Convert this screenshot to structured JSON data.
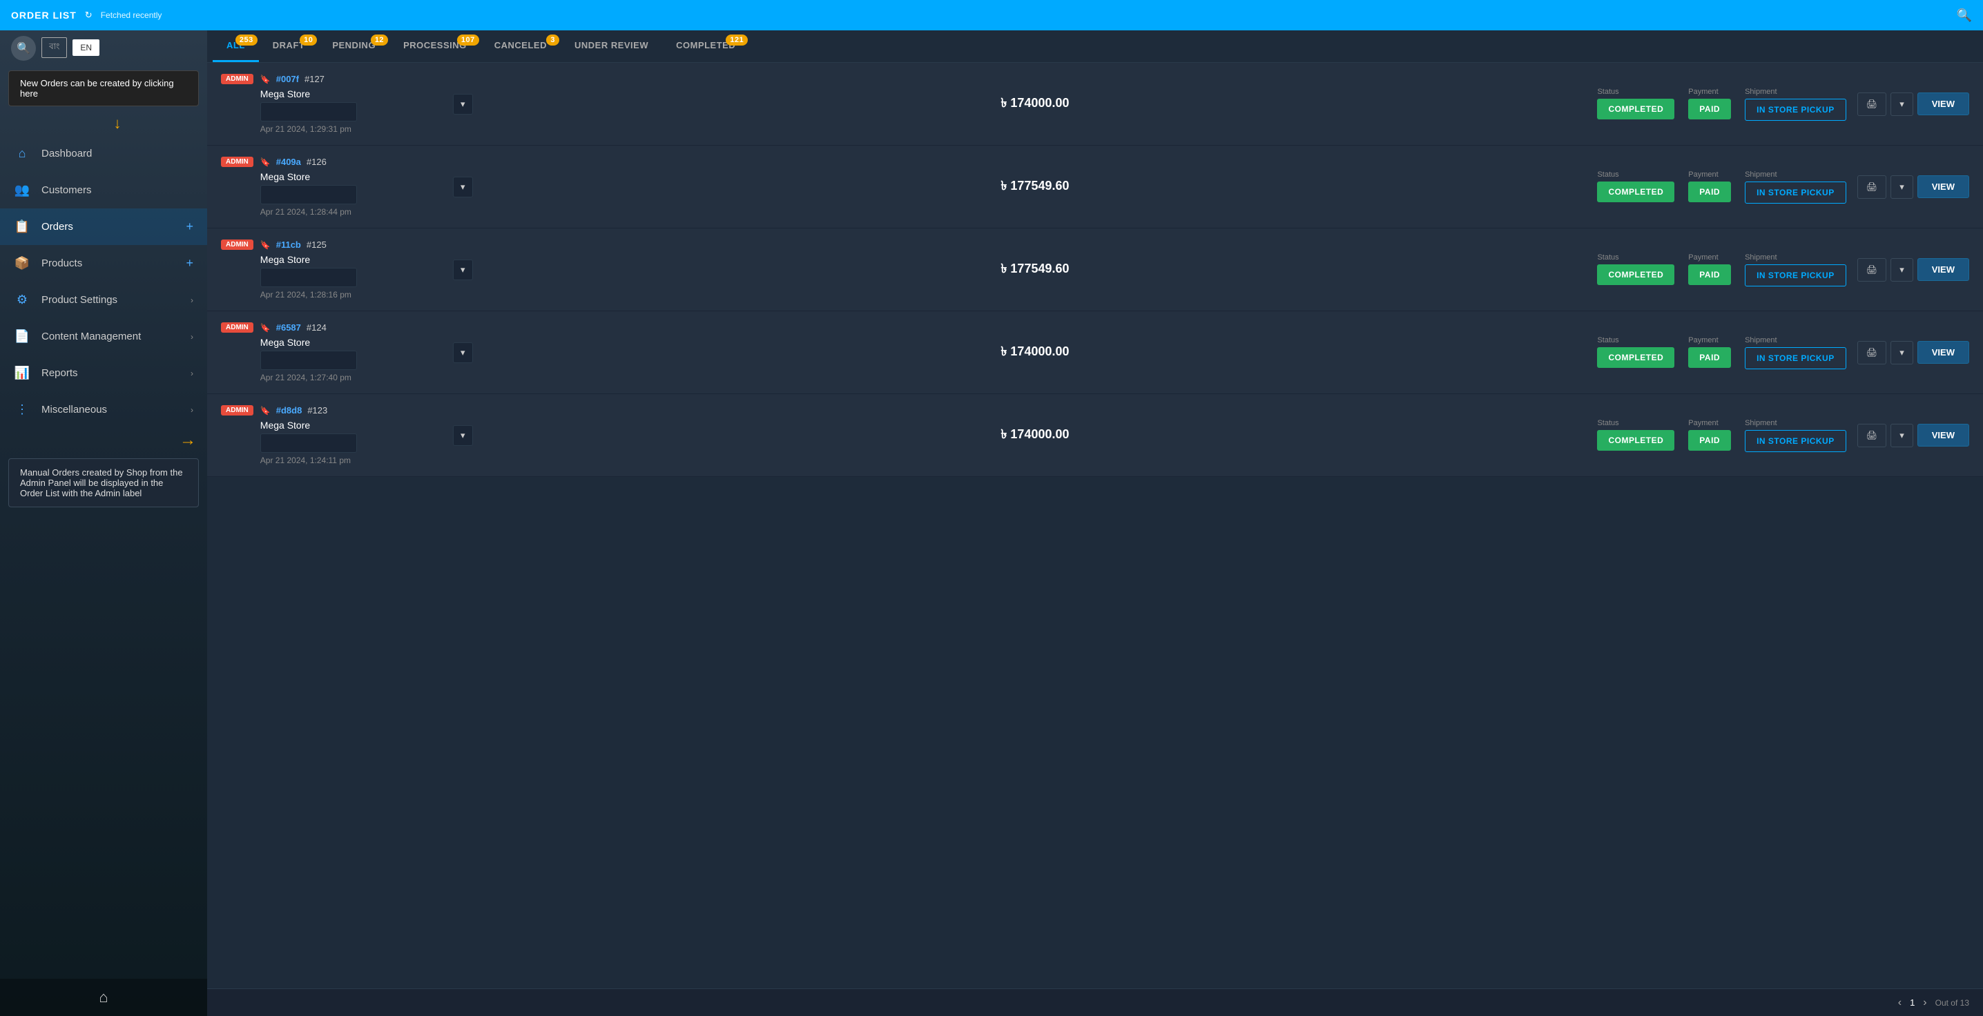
{
  "topbar": {
    "title": "ORDER LIST",
    "refresh_icon": "↻",
    "fetched_label": "Fetched recently",
    "search_icon": "🔍"
  },
  "language": {
    "options": [
      "বাং",
      "EN"
    ],
    "active": "EN"
  },
  "nav": {
    "items": [
      {
        "id": "dashboard",
        "label": "Dashboard",
        "icon": "⌂",
        "has_arrow": false,
        "has_add": false,
        "active": false
      },
      {
        "id": "customers",
        "label": "Customers",
        "icon": "👥",
        "has_arrow": false,
        "has_add": false,
        "active": false
      },
      {
        "id": "orders",
        "label": "Orders",
        "icon": "📋",
        "has_arrow": false,
        "has_add": true,
        "active": true
      },
      {
        "id": "products",
        "label": "Products",
        "icon": "📦",
        "has_arrow": false,
        "has_add": true,
        "active": false
      },
      {
        "id": "product-settings",
        "label": "Product Settings",
        "icon": "⚙",
        "has_arrow": true,
        "has_add": false,
        "active": false
      },
      {
        "id": "content-management",
        "label": "Content Management",
        "icon": "📄",
        "has_arrow": true,
        "has_add": false,
        "active": false
      },
      {
        "id": "reports",
        "label": "Reports",
        "icon": "📊",
        "has_arrow": true,
        "has_add": false,
        "active": false
      },
      {
        "id": "miscellaneous",
        "label": "Miscellaneous",
        "icon": "⋮",
        "has_arrow": true,
        "has_add": false,
        "active": false
      }
    ]
  },
  "tooltips": {
    "top": "New Orders can be created by clicking here",
    "bottom": "Manual Orders created by Shop from the Admin Panel will be displayed in the Order List with the Admin label"
  },
  "tabs": [
    {
      "id": "all",
      "label": "ALL",
      "badge": "253",
      "active": true
    },
    {
      "id": "draft",
      "label": "DRAFT",
      "badge": "10",
      "active": false
    },
    {
      "id": "pending",
      "label": "PENDING",
      "badge": "12",
      "active": false
    },
    {
      "id": "processing",
      "label": "PROCESSING",
      "badge": "107",
      "active": false
    },
    {
      "id": "canceled",
      "label": "CANCELED",
      "badge": "3",
      "active": false
    },
    {
      "id": "under-review",
      "label": "UNDER REVIEW",
      "badge": null,
      "active": false
    },
    {
      "id": "completed",
      "label": "COMPLETED",
      "badge": "121",
      "active": false
    }
  ],
  "orders": [
    {
      "admin": true,
      "hash_id": "#007f",
      "order_num": "#127",
      "store": "Mega Store",
      "date": "Apr 21 2024, 1:29:31 pm",
      "amount": "৳ 174000.00",
      "status": "COMPLETED",
      "payment": "PAID",
      "shipment": "IN STORE PICKUP"
    },
    {
      "admin": true,
      "hash_id": "#409a",
      "order_num": "#126",
      "store": "Mega Store",
      "date": "Apr 21 2024, 1:28:44 pm",
      "amount": "৳ 177549.60",
      "status": "COMPLETED",
      "payment": "PAID",
      "shipment": "IN STORE PICKUP"
    },
    {
      "admin": true,
      "hash_id": "#11cb",
      "order_num": "#125",
      "store": "Mega Store",
      "date": "Apr 21 2024, 1:28:16 pm",
      "amount": "৳ 177549.60",
      "status": "COMPLETED",
      "payment": "PAID",
      "shipment": "IN STORE PICKUP"
    },
    {
      "admin": true,
      "hash_id": "#6587",
      "order_num": "#124",
      "store": "Mega Store",
      "date": "Apr 21 2024, 1:27:40 pm",
      "amount": "৳ 174000.00",
      "status": "COMPLETED",
      "payment": "PAID",
      "shipment": "IN STORE PICKUP"
    },
    {
      "admin": true,
      "hash_id": "#d8d8",
      "order_num": "#123",
      "store": "Mega Store",
      "date": "Apr 21 2024, 1:24:11 pm",
      "amount": "৳ 174000.00",
      "status": "COMPLETED",
      "payment": "PAID",
      "shipment": "IN STORE PICKUP"
    }
  ],
  "pagination": {
    "current": "1",
    "total": "Out of 13",
    "prev_icon": "‹",
    "next_icon": "›"
  },
  "labels": {
    "status": "Status",
    "payment": "Payment",
    "shipment": "Shipment",
    "print_icon": "🖨",
    "dropdown_icon": "▾",
    "view_label": "VIEW",
    "admin_label": "ADMIN"
  }
}
